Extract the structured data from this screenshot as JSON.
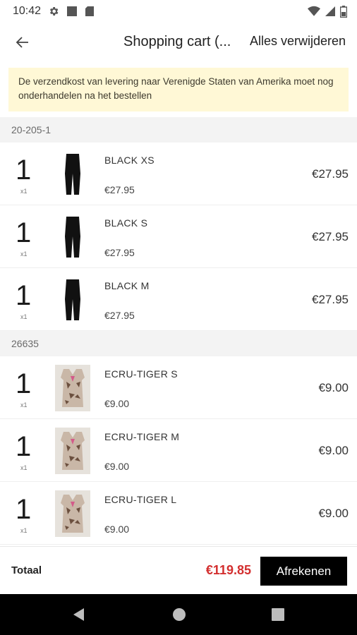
{
  "status_bar": {
    "time": "10:42",
    "left_icons": [
      "gear-icon",
      "square-icon",
      "sd-card-icon"
    ],
    "right_icons": [
      "wifi-icon",
      "cell-signal-icon",
      "battery-icon"
    ]
  },
  "header": {
    "title": "Shopping cart (...",
    "clear_all_label": "Alles verwijderen"
  },
  "notice": {
    "text": "De verzendkost van levering naar Verenigde Staten van Amerika moet nog onderhandelen na het bestellen"
  },
  "groups": [
    {
      "code": "20-205-1",
      "items": [
        {
          "qty": "1",
          "qty_sub": "x1",
          "variant": "BLACK XS",
          "unit_price": "€27.95",
          "line_total": "€27.95",
          "thumb": "black-leggings"
        },
        {
          "qty": "1",
          "qty_sub": "x1",
          "variant": "BLACK S",
          "unit_price": "€27.95",
          "line_total": "€27.95",
          "thumb": "black-leggings"
        },
        {
          "qty": "1",
          "qty_sub": "x1",
          "variant": "BLACK M",
          "unit_price": "€27.95",
          "line_total": "€27.95",
          "thumb": "black-leggings"
        }
      ]
    },
    {
      "code": "26635",
      "items": [
        {
          "qty": "1",
          "qty_sub": "x1",
          "variant": "ECRU-TIGER S",
          "unit_price": "€9.00",
          "line_total": "€9.00",
          "thumb": "tiger-top"
        },
        {
          "qty": "1",
          "qty_sub": "x1",
          "variant": "ECRU-TIGER M",
          "unit_price": "€9.00",
          "line_total": "€9.00",
          "thumb": "tiger-top"
        },
        {
          "qty": "1",
          "qty_sub": "x1",
          "variant": "ECRU-TIGER L",
          "unit_price": "€9.00",
          "line_total": "€9.00",
          "thumb": "tiger-top"
        }
      ]
    }
  ],
  "footer": {
    "total_label": "Totaal",
    "total_value": "€119.85",
    "checkout_label": "Afrekenen"
  },
  "colors": {
    "notice_bg": "#fff8d6",
    "total": "#d32f2f",
    "checkout_bg": "#000000"
  }
}
